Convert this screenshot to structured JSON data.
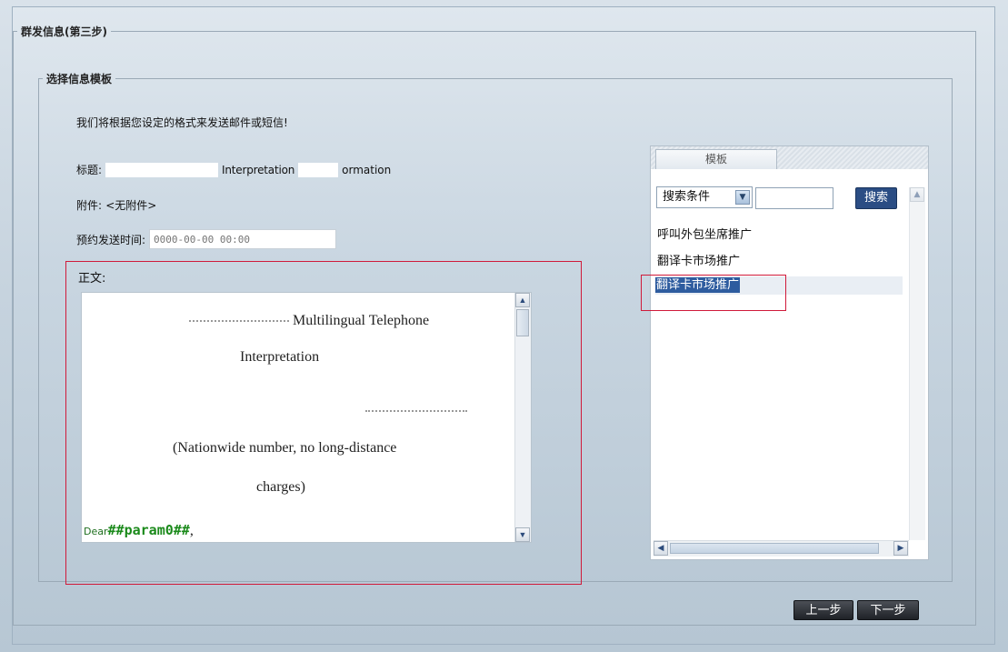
{
  "window": {
    "title": "群发信息(第三步)"
  },
  "section": {
    "title": "选择信息模板"
  },
  "intro": "我们将根据您设定的格式来发送邮件或短信!",
  "subject": {
    "label": "标题:",
    "visible_text_1": "Interpretation",
    "visible_text_2": "ormation"
  },
  "attachment": {
    "label": "附件:",
    "value": "<无附件>"
  },
  "schedule": {
    "label": "预约发送时间:",
    "placeholder": "0000-00-00 00:00"
  },
  "body": {
    "label": "正文:",
    "lines": [
      "Multilingual Telephone",
      "Interpretation",
      "(Nationwide number, no long-distance",
      "charges)"
    ],
    "dear_prefix": "Dear",
    "param": "##param0##",
    "dear_suffix": ","
  },
  "templates": {
    "tab_label": "模板",
    "search_condition": "搜索条件",
    "search_button": "搜索",
    "items": [
      "呼叫外包坐席推广",
      "翻译卡市场推广",
      "翻译卡市场推广"
    ],
    "selected_index": 2
  },
  "nav": {
    "prev_label": "上一步",
    "next_label": "下一步"
  }
}
